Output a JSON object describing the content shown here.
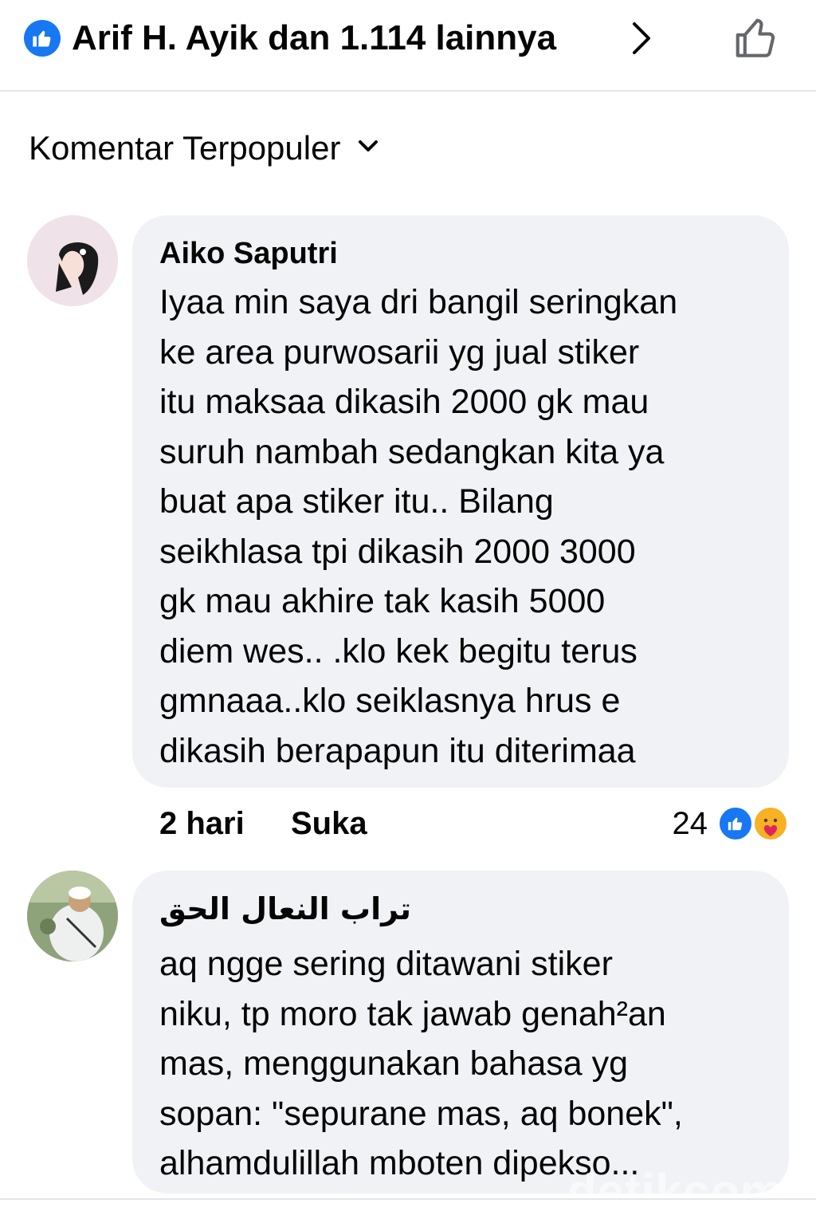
{
  "reactions_bar": {
    "reactors_text": "Arif H. Ayik dan 1.114 lainnya",
    "like_badge_icon": "like-icon",
    "chevron_icon": "chevron-right-icon",
    "like_button_icon": "thumbs-up-outline-icon"
  },
  "sort": {
    "label": "Komentar Terpopuler",
    "icon": "chevron-down-icon"
  },
  "comments": [
    {
      "author": "Aiko Saputri",
      "text": "Iyaa min saya dri bangil seringkan\nke area purwosarii yg jual stiker\nitu maksaa dikasih 2000 gk mau\nsuruh nambah sedangkan kita ya\nbuat apa stiker itu.. Bilang\nseikhlasa tpi dikasih 2000 3000\ngk mau akhire tak kasih 5000\ndiem wes.. .klo kek begitu terus\ngmnaaa..klo seiklasnya hrus e\ndikasih berapapun itu diterimaa",
      "time": "2 hari",
      "like_label": "Suka",
      "reaction_count": "24",
      "reaction_icons": [
        "like-icon",
        "care-icon"
      ]
    },
    {
      "author": "تراب النعال الحق",
      "text": "aq ngge sering ditawani stiker\nniku, tp moro tak jawab genah²an\nmas, menggunakan bahasa yg\nsopan: \"sepurane mas, aq bonek\",\nalhamdulillah mboten dipekso..."
    }
  ],
  "watermark": "detikcom",
  "colors": {
    "brand_blue": "#1877f2",
    "bubble_bg": "#f0f2f5",
    "divider": "#e4e6eb",
    "care_yellow": "#f7b125"
  }
}
